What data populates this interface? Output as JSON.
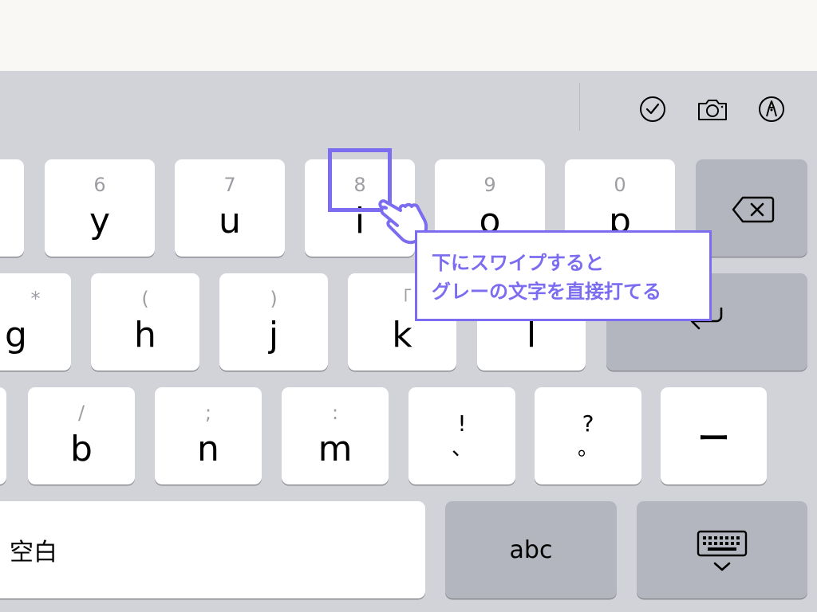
{
  "toolbar": {
    "icons": [
      "checkmark-circle-icon",
      "camera-icon",
      "markup-pen-icon"
    ]
  },
  "keyboard": {
    "row1": [
      {
        "secondary": "",
        "primary": ""
      },
      {
        "secondary": "6",
        "primary": "y"
      },
      {
        "secondary": "7",
        "primary": "u"
      },
      {
        "secondary": "8",
        "primary": "i"
      },
      {
        "secondary": "9",
        "primary": "o"
      },
      {
        "secondary": "0",
        "primary": "p"
      }
    ],
    "row2": [
      {
        "secondary": "*",
        "primary": "g"
      },
      {
        "secondary": "(",
        "primary": "h"
      },
      {
        "secondary": ")",
        "primary": "j"
      },
      {
        "secondary": "「",
        "primary": "k"
      },
      {
        "secondary": "」",
        "primary": "l"
      }
    ],
    "row3": [
      {
        "secondary": "/",
        "primary": "b"
      },
      {
        "secondary": ";",
        "primary": "n"
      },
      {
        "secondary": ":",
        "primary": "m"
      }
    ],
    "punct1": {
      "top": "!",
      "bottom": "、"
    },
    "punct2": {
      "top": "?",
      "bottom": "。"
    },
    "dash_label": "ー",
    "space_label": "空白",
    "abc_label": "abc"
  },
  "annotation": {
    "line1": "下にスワイプすると",
    "line2": "グレーの文字を直接打てる",
    "accent_color": "#7b6cf0"
  }
}
